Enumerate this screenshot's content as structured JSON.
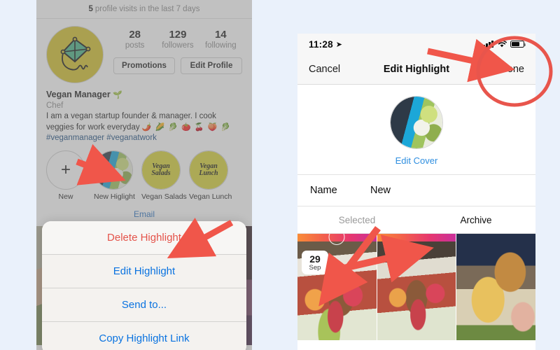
{
  "page": {
    "background_color": "#eaf1fb",
    "annotation_color": "#f0564a"
  },
  "left_phone": {
    "name": "instagram-profile-screen",
    "visits_banner": {
      "count": "5",
      "text": "profile visits in the last 7 days"
    },
    "avatar": {
      "icon": "kite-icon",
      "background_color": "#d4c32f"
    },
    "stats": [
      {
        "number": "28",
        "label": "posts"
      },
      {
        "number": "129",
        "label": "followers"
      },
      {
        "number": "14",
        "label": "following"
      }
    ],
    "buttons": [
      {
        "label": "Promotions"
      },
      {
        "label": "Edit Profile"
      }
    ],
    "bio": {
      "display_name": "Vegan Manager",
      "name_emoji": "🌱",
      "category": "Chef",
      "description_line1": "I am a vegan startup founder & manager.  I cook",
      "description_line2": "veggies for work everyday",
      "description_emoji": "🌶️ 🌽 🥬 🍅 🍒 🍑 🥬",
      "hashtags": "#veganmanager #veganatwork"
    },
    "highlights": [
      {
        "label": "New",
        "type": "add"
      },
      {
        "label": "New Higlight",
        "type": "photo"
      },
      {
        "label": "Vegan Salads",
        "type": "logo",
        "logo_line1": "Vegan",
        "logo_line2": "Salads"
      },
      {
        "label": "Vegan Lunch",
        "type": "logo",
        "logo_line1": "Vegan",
        "logo_line2": "Lunch"
      }
    ],
    "email_link": "Email",
    "action_sheet": [
      {
        "label": "Delete Highlight",
        "style": "destructive"
      },
      {
        "label": "Edit Highlight",
        "style": "default"
      },
      {
        "label": "Send to...",
        "style": "default"
      },
      {
        "label": "Copy Highlight Link",
        "style": "default"
      }
    ]
  },
  "right_phone": {
    "name": "edit-highlight-screen",
    "status_bar": {
      "time": "11:28",
      "location_icon": "location-arrow-icon",
      "signal_icon": "cellular-signal-icon",
      "wifi_icon": "wifi-icon",
      "battery_icon": "battery-icon"
    },
    "nav": {
      "cancel_label": "Cancel",
      "title": "Edit Highlight",
      "done_label": "Done"
    },
    "cover": {
      "edit_cover_label": "Edit Cover"
    },
    "name_field": {
      "label": "Name",
      "value": "New"
    },
    "tabs": [
      {
        "label": "Selected",
        "active": false
      },
      {
        "label": "Archive",
        "active": true
      }
    ],
    "grid": [
      {
        "name": "thumbnail-poke-bowl",
        "selected": true,
        "date_day": "29",
        "date_month": "Sep"
      },
      {
        "name": "thumbnail-poke-bowl-table",
        "selected": false
      },
      {
        "name": "thumbnail-burger-fries",
        "selected": false
      }
    ]
  },
  "annotations": [
    {
      "name": "arrow-to-new-highlight",
      "type": "arrow"
    },
    {
      "name": "arrow-to-delete-highlight",
      "type": "arrow"
    },
    {
      "name": "arrow-to-done-button",
      "type": "arrow"
    },
    {
      "name": "circle-around-done-button",
      "type": "circle"
    },
    {
      "name": "arrow-to-selected-tab",
      "type": "arrow"
    },
    {
      "name": "arrow-to-second-thumbnail",
      "type": "arrow"
    }
  ]
}
